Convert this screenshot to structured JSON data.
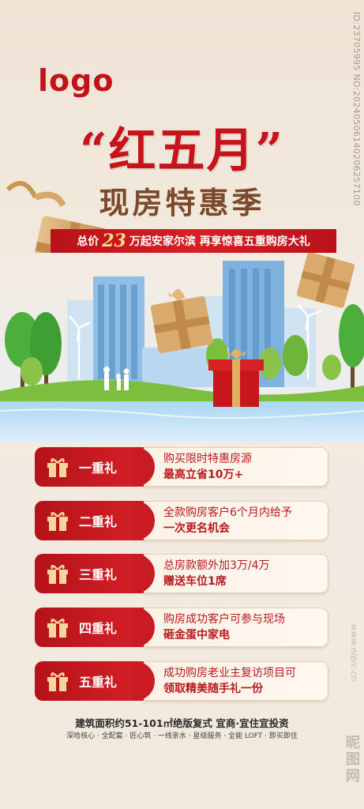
{
  "logo": "logo",
  "title_main": "“红五月”",
  "title_sub": "现房特惠季",
  "banner": {
    "pre": "总价",
    "num": "23",
    "post": "万起安家尔滨  再享惊喜五重购房大礼"
  },
  "gifts": [
    {
      "label": "一重礼",
      "line1": "购买限时特惠房源",
      "line2": "最高立省10万+"
    },
    {
      "label": "二重礼",
      "line1": "全款购房客户6个月内给予",
      "line2": "一次更名机会"
    },
    {
      "label": "三重礼",
      "line1": "总房款额外加3万/4万",
      "line2": "赠送车位1席"
    },
    {
      "label": "四重礼",
      "line1": "购房成功客户可参与现场",
      "line2": "砸金蛋中家电"
    },
    {
      "label": "五重礼",
      "line1": "成功购房老业主复访项目可",
      "line2": "领取精美随手礼一份"
    }
  ],
  "footer": {
    "area": "建筑面积约51-101㎡绝版复式   宜商·宜住宜投资",
    "features": "深哈核心 · 全配套 · 匠心筑 · 一线亲水 · 星级服务 · 全能 LOFT · 即买即住"
  },
  "side_id": "ID:23705995 NO:20240506140206257100",
  "watermark_url": "www.nipic.cn",
  "watermark_brand": "昵图网",
  "colors": {
    "red": "#c5141c",
    "brown": "#7c4a2b",
    "cream": "#f3ebe1"
  },
  "icons": {
    "gift": "gift-icon"
  }
}
